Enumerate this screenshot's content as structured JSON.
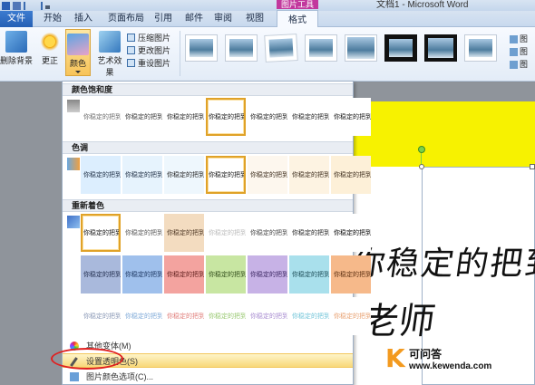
{
  "window": {
    "title": "文档1 - Microsoft Word"
  },
  "tabs": [
    {
      "label": "文件"
    },
    {
      "label": "开始"
    },
    {
      "label": "插入"
    },
    {
      "label": "页面布局"
    },
    {
      "label": "引用"
    },
    {
      "label": "邮件"
    },
    {
      "label": "审阅"
    },
    {
      "label": "视图"
    },
    {
      "label": "格式"
    }
  ],
  "contextual_tab_group": "图片工具",
  "ribbon": {
    "remove_background": "删除背景",
    "corrections": "更正",
    "color": "颜色",
    "artistic_effects": "艺术效果",
    "compress": "压缩图片",
    "change": "更改图片",
    "reset": "重设图片",
    "right_cmds": [
      "图",
      "图",
      "图"
    ]
  },
  "color_menu": {
    "saturation_header": "颜色饱和度",
    "tone_header": "色调",
    "recolor_header": "重新着色",
    "items": {
      "more_variations": "其他变体(M)",
      "set_transparent": "设置透明色(S)",
      "picture_color_options": "图片颜色选项(C)..."
    },
    "swatch_text": "你稳定的把到我吗",
    "saturation_swatches": [
      {
        "bg": "#ffffff",
        "fg": "#6b6b6b"
      },
      {
        "bg": "#ffffff",
        "fg": "#333333"
      },
      {
        "bg": "#ffffff",
        "fg": "#222222"
      },
      {
        "bg": "#ffffff",
        "fg": "#111111"
      },
      {
        "bg": "#ffffff",
        "fg": "#1a1a1a"
      },
      {
        "bg": "#ffffff",
        "fg": "#1a1a1a"
      },
      {
        "bg": "#ffffff",
        "fg": "#111111"
      }
    ],
    "saturation_selected": 3,
    "tone_swatches": [
      {
        "bg": "#dceefe",
        "fg": "#1a2a40"
      },
      {
        "bg": "#e6f3fd",
        "fg": "#1a2a40"
      },
      {
        "bg": "#eef7fd",
        "fg": "#222"
      },
      {
        "bg": "#ffffff",
        "fg": "#111"
      },
      {
        "bg": "#fdf7ee",
        "fg": "#3a2a1a"
      },
      {
        "bg": "#fdf3e2",
        "fg": "#3a2a1a"
      },
      {
        "bg": "#fdf0d8",
        "fg": "#3a2a1a"
      }
    ],
    "tone_selected": 3,
    "recolor_row1": [
      {
        "bg": "#ffffff",
        "fg": "#111"
      },
      {
        "bg": "#ffffff",
        "fg": "#555"
      },
      {
        "bg": "#f3dcc0",
        "fg": "#4a3320"
      },
      {
        "bg": "#ffffff",
        "fg": "#bbbbbb"
      },
      {
        "bg": "#ffffff",
        "fg": "#444"
      },
      {
        "bg": "#ffffff",
        "fg": "#222"
      },
      {
        "bg": "#ffffff",
        "fg": "#000"
      }
    ],
    "recolor_selected": 0,
    "recolor_row2": [
      {
        "bg": "#a9b9dc",
        "fg": "#1e2a4a"
      },
      {
        "bg": "#9fc0ec",
        "fg": "#1b3560"
      },
      {
        "bg": "#f3a39f",
        "fg": "#5a1a18"
      },
      {
        "bg": "#c8e6a2",
        "fg": "#2e4a18"
      },
      {
        "bg": "#c7b2e6",
        "fg": "#3a2560"
      },
      {
        "bg": "#a9e0ec",
        "fg": "#1a4a55"
      },
      {
        "bg": "#f6b98a",
        "fg": "#5a2e10"
      }
    ],
    "recolor_row3": [
      {
        "bg": "#ffffff",
        "fg": "#8a98b6"
      },
      {
        "bg": "#ffffff",
        "fg": "#7faad8"
      },
      {
        "bg": "#ffffff",
        "fg": "#e07c78"
      },
      {
        "bg": "#ffffff",
        "fg": "#98c870"
      },
      {
        "bg": "#ffffff",
        "fg": "#a78bd0"
      },
      {
        "bg": "#ffffff",
        "fg": "#70c4d8"
      },
      {
        "bg": "#ffffff",
        "fg": "#e8a070"
      }
    ]
  },
  "document": {
    "line1": "你稳定的把到我吗",
    "line2": "老师"
  },
  "watermark": {
    "logo": "K",
    "name": "可问答",
    "url": "www.kewenda.com"
  }
}
